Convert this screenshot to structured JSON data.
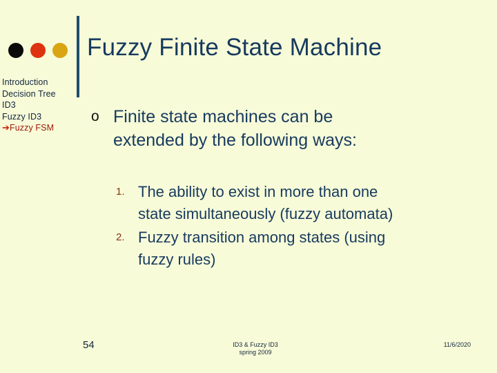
{
  "slide": {
    "title": "Fuzzy Finite State Machine",
    "background_color": "#f7fbd8",
    "title_color": "#173a5e"
  },
  "decor": {
    "dots": [
      {
        "name": "dot-black",
        "color": "#0a0a0a"
      },
      {
        "name": "dot-red",
        "color": "#dd3311"
      },
      {
        "name": "dot-gold",
        "color": "#d9a512"
      }
    ],
    "rule_color": "#1f4e6e"
  },
  "sidebar": {
    "items": [
      {
        "label": "Introduction",
        "current": false,
        "arrow": ""
      },
      {
        "label": "Decision  Tree",
        "current": false,
        "arrow": ""
      },
      {
        "label": "ID3",
        "current": false,
        "arrow": ""
      },
      {
        "label": "Fuzzy ID3",
        "current": false,
        "arrow": ""
      },
      {
        "label": "Fuzzy  FSM",
        "current": true,
        "arrow": "➔"
      }
    ],
    "current_color": "#9e1a0a",
    "item_color": "#14253d"
  },
  "content": {
    "bullet_marker": "o",
    "bullet_line1": "Finite state machines can be",
    "bullet_line2": "extended by the following ways:",
    "numbered_items": [
      {
        "marker": "1.",
        "line1": "The ability to exist in more than one",
        "line2": "state simultaneously (fuzzy automata)"
      },
      {
        "marker": "2.",
        "line1": "Fuzzy transition among states (using",
        "line2": "fuzzy rules)"
      }
    ],
    "text_color": "#173a5e",
    "number_color": "#8a3310"
  },
  "footer": {
    "page_number": "54",
    "center_line1": "ID3 & Fuzzy ID3",
    "center_line2": "spring 2009",
    "date": "11/6/2020"
  }
}
